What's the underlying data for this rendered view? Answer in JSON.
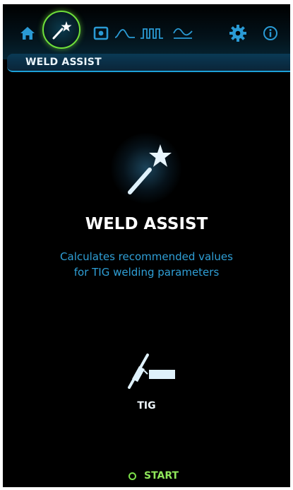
{
  "nav": {
    "items": [
      {
        "icon": "home-icon"
      },
      {
        "icon": "magic-wand-icon",
        "active": true
      },
      {
        "icon": "memory-icon"
      },
      {
        "icon": "pulse-curve-icon"
      },
      {
        "icon": "square-wave-icon"
      },
      {
        "icon": "ac-wave-icon"
      },
      {
        "icon": "gear-icon"
      },
      {
        "icon": "info-icon"
      }
    ],
    "active_ring_color": "#6fe03a",
    "icon_color": "#2a9ad4"
  },
  "section": {
    "title": "WELD ASSIST"
  },
  "main": {
    "icon": "magic-wand-icon",
    "title": "WELD ASSIST",
    "description_line1": "Calculates recommended values",
    "description_line2": "for TIG welding parameters",
    "description_color": "#2f9fd6"
  },
  "process": {
    "icon": "tig-torch-icon",
    "label": "TIG"
  },
  "action": {
    "label": "START",
    "color": "#7ce04a"
  }
}
